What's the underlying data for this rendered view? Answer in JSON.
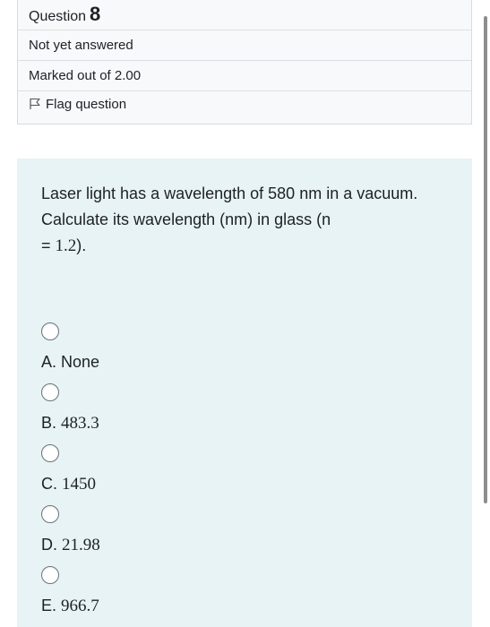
{
  "question_info": {
    "question_label": "Question",
    "question_number": "8",
    "state": "Not yet answered",
    "marks": "Marked out of 2.00",
    "flag_label": "Flag question"
  },
  "question": {
    "text_main": "Laser light has a wavelength of 580 nm in a vacuum. Calculate its wavelength (nm) in glass (n",
    "text_eq": "= ",
    "text_value": "1.2",
    "text_end": ")."
  },
  "options": [
    {
      "letter": "A.",
      "value": "None",
      "serif": false
    },
    {
      "letter": "B.",
      "value": "483.3",
      "serif": true
    },
    {
      "letter": "C.",
      "value": "1450",
      "serif": true
    },
    {
      "letter": "D.",
      "value": "21.98",
      "serif": true
    },
    {
      "letter": "E.",
      "value": "966.7",
      "serif": true
    }
  ],
  "colors": {
    "info_background": "#f8f9fa",
    "content_background": "#e7f3f5"
  },
  "icons": {
    "flag": "flag-icon"
  }
}
